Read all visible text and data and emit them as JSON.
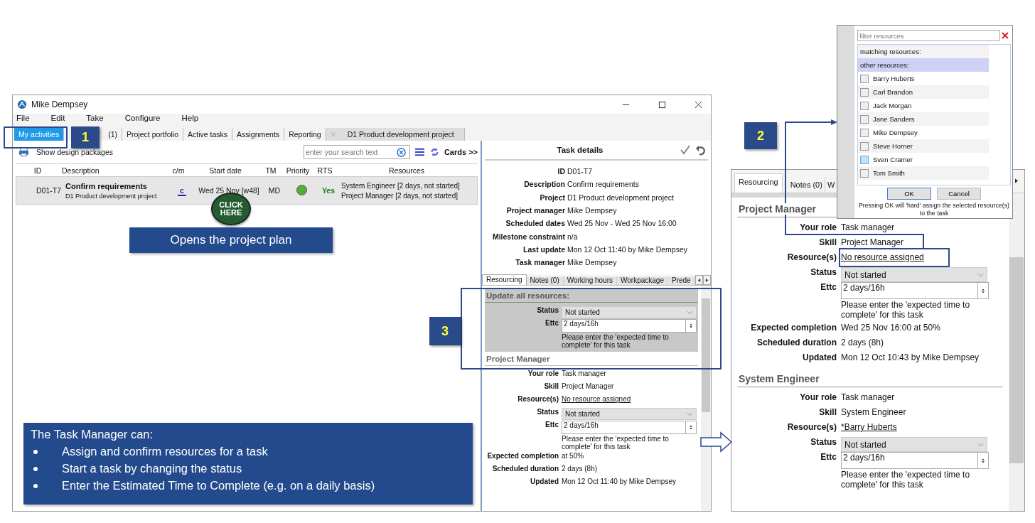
{
  "main_window": {
    "title": "Mike Dempsey",
    "menu": [
      "File",
      "Edit",
      "Take",
      "Configure",
      "Help"
    ],
    "tabs": [
      {
        "label": "My activities",
        "selected": true,
        "closable": false
      },
      {
        "label": "(1)",
        "selected": false,
        "closable": false
      },
      {
        "label": "Project portfolio",
        "selected": false,
        "closable": false
      },
      {
        "label": "Active tasks",
        "selected": false,
        "closable": false
      },
      {
        "label": "Assignments",
        "selected": false,
        "closable": false
      },
      {
        "label": "Reporting",
        "selected": false,
        "closable": false
      },
      {
        "label": "D1 Product development project",
        "selected": false,
        "closable": true
      }
    ],
    "toolbar": {
      "design_packages": "Show design packages",
      "search_placeholder": "enter your search text",
      "cards": "Cards >>"
    },
    "table": {
      "columns": [
        "ID",
        "Description",
        "c/m",
        "Start date",
        "TM",
        "Priority",
        "RTS",
        "Resources"
      ],
      "rows": [
        {
          "selected": true,
          "id": "D01-T7",
          "title": "Confirm requirements",
          "project": "D1 Product development project",
          "cm": "c",
          "start": "Wed 25 Nov [w48]",
          "tm": "MD",
          "color": "#4caf3e",
          "rts": "Yes",
          "resources": [
            "System Engineer [2 days, not started]",
            "Project Manager [2 days, not started]"
          ]
        }
      ]
    },
    "click_button": [
      "CLICK",
      "HERE"
    ],
    "task_details": {
      "title": "Task details",
      "fields": [
        {
          "label": "ID",
          "value": "D01-T7"
        },
        {
          "label": "Description",
          "value": "Confirm requirements"
        },
        {
          "label": "Project",
          "value": "D1 Product development project"
        },
        {
          "label": "Project manager",
          "value": "Mike Dempsey"
        },
        {
          "label": "Scheduled dates",
          "value": "Wed 25 Nov - Wed 25 Nov 16:00"
        },
        {
          "label": "Milestone constraint",
          "value": "n/a"
        },
        {
          "label": "Last update",
          "value": "Mon 12 Oct 11:40 by Mike Dempsey"
        },
        {
          "label": "Task manager",
          "value": "Mike Dempsey"
        }
      ],
      "tabs": [
        {
          "label": "Resourcing",
          "selected": true
        },
        {
          "label": "Notes (0)",
          "selected": false
        },
        {
          "label": "Working hours",
          "selected": false
        },
        {
          "label": "Workpackage",
          "selected": false
        },
        {
          "label": "Prede",
          "selected": false
        }
      ],
      "sections": [
        {
          "kind": "bulk",
          "heading": "Update all resources:",
          "fields": [
            {
              "kind": "select",
              "label": "Status",
              "value": "Not started"
            },
            {
              "kind": "spinner",
              "label": "Ettc",
              "value": "2 days/16h",
              "hint": "Please enter the 'expected time to complete' for this task"
            }
          ]
        },
        {
          "kind": "resource",
          "heading": "Project Manager",
          "fields": [
            {
              "kind": "text",
              "label": "Your role",
              "value": "Task manager"
            },
            {
              "kind": "text",
              "label": "Skill",
              "value": "Project Manager"
            },
            {
              "kind": "link",
              "label": "Resource(s)",
              "value": "No resource assigned"
            },
            {
              "kind": "select",
              "label": "Status",
              "value": "Not started"
            },
            {
              "kind": "spinner",
              "label": "Ettc",
              "value": "2 days/16h",
              "hint": "Please enter the 'expected time to complete' for this task"
            },
            {
              "kind": "text",
              "label": "Expected completion",
              "value": "at 50%"
            },
            {
              "kind": "text",
              "label": "Scheduled duration",
              "value": "2 days (8h)"
            },
            {
              "kind": "text",
              "label": "Updated",
              "value": "Mon 12 Oct 11:40 by Mike Dempsey"
            }
          ]
        }
      ]
    }
  },
  "zoom_panel": {
    "tabs": [
      {
        "label": "Resourcing",
        "selected": true
      },
      {
        "label": "Notes (0)",
        "selected": false
      },
      {
        "label": "W",
        "selected": false
      }
    ],
    "sections": [
      {
        "kind": "resource",
        "heading": "Project Manager",
        "fields": [
          {
            "kind": "text",
            "label": "Your role",
            "value": "Task manager"
          },
          {
            "kind": "text",
            "label": "Skill",
            "value": "Project Manager"
          },
          {
            "kind": "link",
            "label": "Resource(s)",
            "value": "No resource assigned"
          },
          {
            "kind": "select",
            "label": "Status",
            "value": "Not started"
          },
          {
            "kind": "spinner",
            "label": "Ettc",
            "value": "2 days/16h",
            "hint": "Please enter the 'expected time to complete' for this task"
          },
          {
            "kind": "text",
            "label": "Expected completion",
            "value": "Wed 25 Nov 16:00 at 50%"
          },
          {
            "kind": "text",
            "label": "Scheduled duration",
            "value": "2 days (8h)"
          },
          {
            "kind": "text",
            "label": "Updated",
            "value": "Mon 12 Oct 10:43 by Mike Dempsey"
          }
        ]
      },
      {
        "kind": "resource",
        "heading": "System Engineer",
        "fields": [
          {
            "kind": "text",
            "label": "Your role",
            "value": "Task manager"
          },
          {
            "kind": "text",
            "label": "Skill",
            "value": "System Engineer"
          },
          {
            "kind": "link",
            "label": "Resource(s)",
            "value": "*Barry Huberts"
          },
          {
            "kind": "select",
            "label": "Status",
            "value": "Not started"
          },
          {
            "kind": "spinner",
            "label": "Ettc",
            "value": "2 days/16h",
            "hint": "Please enter the 'expected time to complete' for this task"
          }
        ]
      }
    ]
  },
  "resource_picker": {
    "filter_placeholder": "filter resources",
    "groups": [
      {
        "label": "matching resources:",
        "selected": false
      },
      {
        "label": "other resources:",
        "selected": true
      }
    ],
    "resources": [
      {
        "name": "Barry Huberts",
        "checked": false,
        "hovered": false
      },
      {
        "name": "Carl Brandon",
        "checked": false,
        "hovered": false
      },
      {
        "name": "Jack Morgan",
        "checked": false,
        "hovered": false
      },
      {
        "name": "Jane Sanders",
        "checked": false,
        "hovered": false
      },
      {
        "name": "Mike Dempsey",
        "checked": false,
        "hovered": false
      },
      {
        "name": "Steve Horner",
        "checked": false,
        "hovered": false
      },
      {
        "name": "Sven Cramer",
        "checked": false,
        "hovered": true
      },
      {
        "name": "Tom Smith",
        "checked": false,
        "hovered": false
      }
    ],
    "buttons": [
      "OK",
      "Cancel"
    ],
    "note": "Pressing OK will 'hard' assign the selected resource(s) to the task"
  },
  "callouts": [
    "1",
    "2",
    "3"
  ],
  "banner": "Opens the project plan",
  "info_box": {
    "title": "The Task Manager can:",
    "bullets": [
      "Assign and confirm resources for a task",
      "Start a task by changing the status",
      "Enter the Estimated Time to Complete (e.g. on a daily basis)"
    ]
  }
}
